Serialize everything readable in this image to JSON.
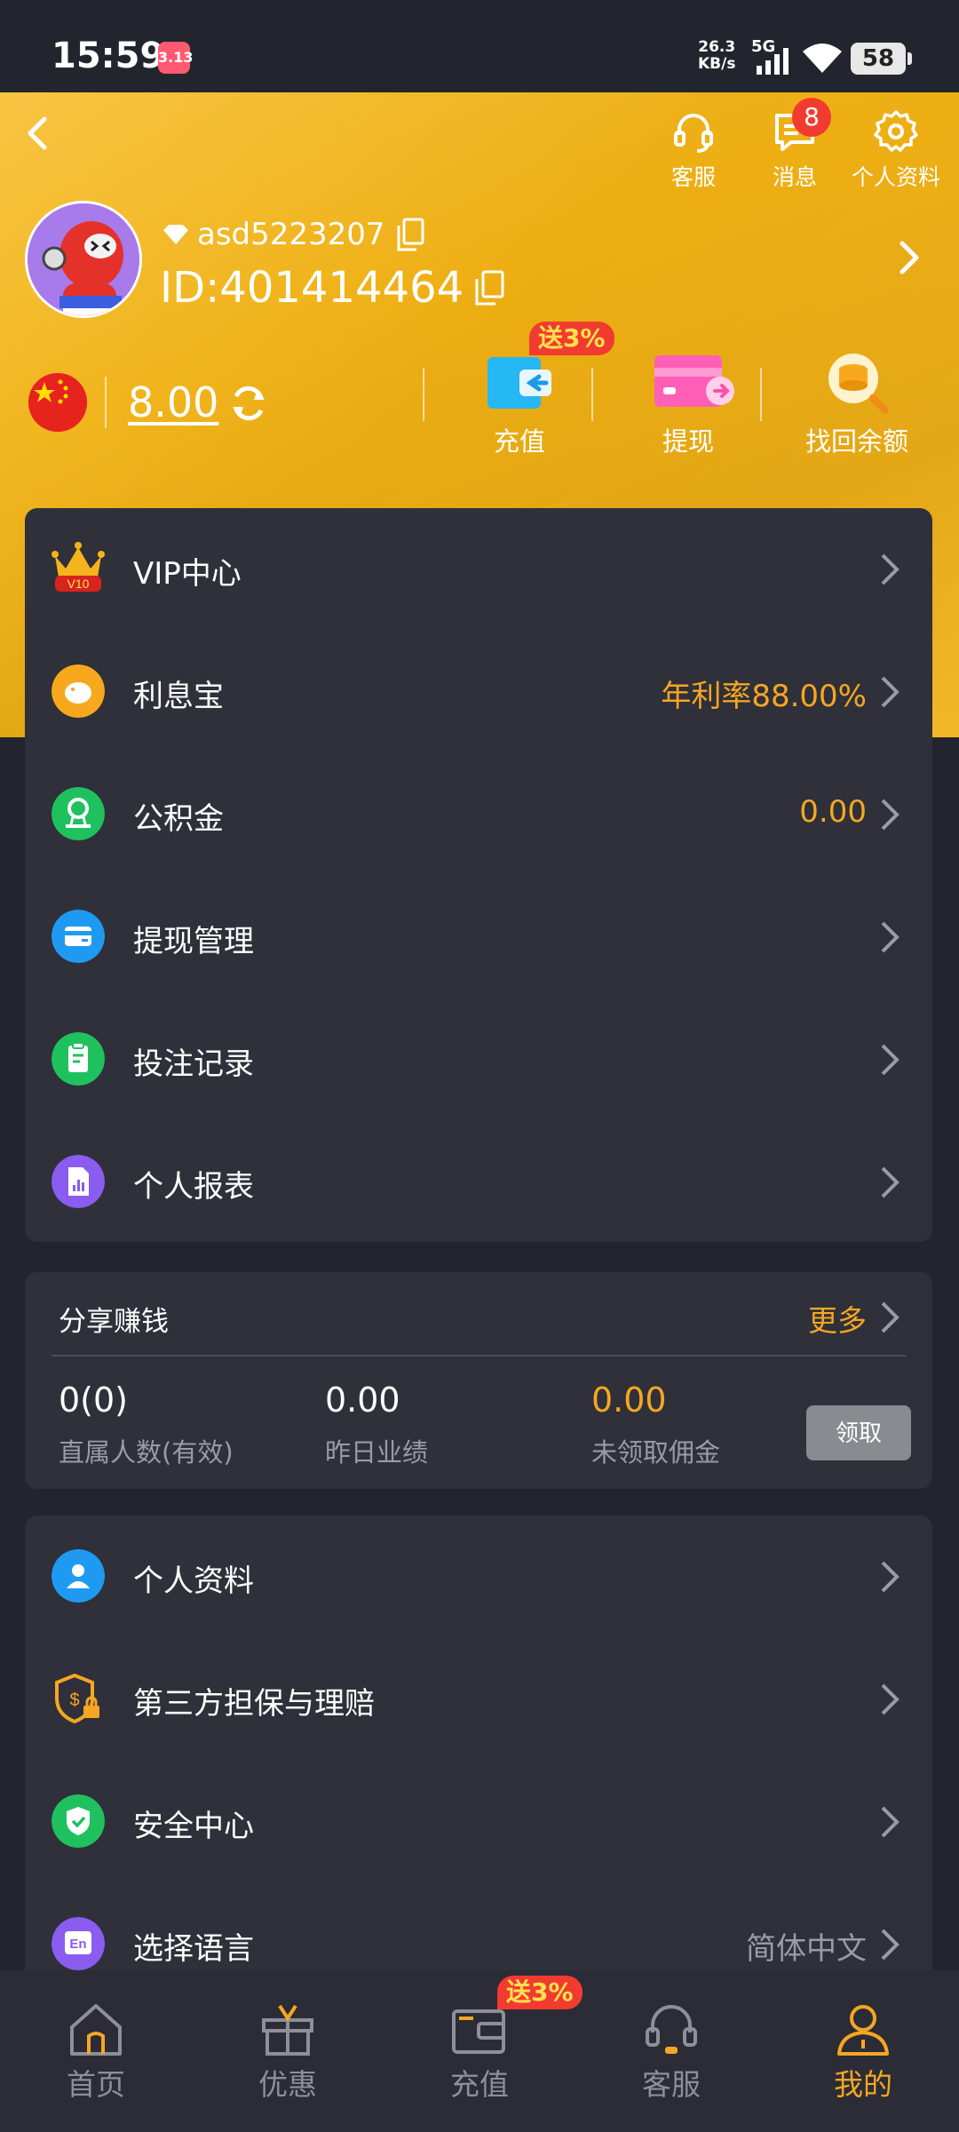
{
  "status_bar": {
    "time": "15:59",
    "app_badge": "3.13",
    "net_speed_value": "26.3",
    "net_speed_unit": "KB/s",
    "network_type": "5G",
    "battery": "58"
  },
  "header": {
    "top_actions": {
      "service_label": "客服",
      "messages_label": "消息",
      "messages_count": "8",
      "profile_label": "个人资料"
    },
    "username": "asd5223207",
    "user_id": "ID:401414464",
    "balance": "8.00",
    "quick_actions": {
      "deposit_label": "充值",
      "deposit_bonus": "送3%",
      "withdraw_label": "提现",
      "recover_label": "找回余额"
    }
  },
  "menu_main": [
    {
      "label": "VIP中心",
      "value": "",
      "icon": "vip-crown-icon"
    },
    {
      "label": "利息宝",
      "value": "年利率88.00%",
      "icon": "piggy-bank-icon"
    },
    {
      "label": "公积金",
      "value": "0.00",
      "icon": "fund-icon"
    },
    {
      "label": "提现管理",
      "value": "",
      "icon": "card-icon"
    },
    {
      "label": "投注记录",
      "value": "",
      "icon": "clipboard-icon"
    },
    {
      "label": "个人报表",
      "value": "",
      "icon": "report-icon"
    }
  ],
  "vip_level_badge": "V10",
  "share": {
    "title": "分享赚钱",
    "more": "更多",
    "stats": [
      {
        "value": "0(0)",
        "label": "直属人数(有效)"
      },
      {
        "value": "0.00",
        "label": "昨日业绩"
      },
      {
        "value": "0.00",
        "label": "未领取佣金"
      }
    ],
    "claim_button": "领取"
  },
  "menu_secondary": [
    {
      "label": "个人资料",
      "value": "",
      "icon": "user-icon"
    },
    {
      "label": "第三方担保与理赔",
      "value": "",
      "icon": "shield-lock-icon"
    },
    {
      "label": "安全中心",
      "value": "",
      "icon": "security-shield-icon"
    },
    {
      "label": "选择语言",
      "value": "简体中文",
      "icon": "language-icon"
    }
  ],
  "language_icon_text": "En",
  "bottom_nav": [
    {
      "label": "首页",
      "icon": "home-icon"
    },
    {
      "label": "优惠",
      "icon": "gift-icon"
    },
    {
      "label": "充值",
      "icon": "wallet-icon",
      "badge": "送3%"
    },
    {
      "label": "客服",
      "icon": "headset-icon"
    },
    {
      "label": "我的",
      "icon": "profile-icon",
      "active": true
    }
  ],
  "colors": {
    "header": "#f2b21b",
    "accent": "#f5a623",
    "background": "#23252e",
    "card": "#2f3039",
    "badge": "#f23b30"
  }
}
